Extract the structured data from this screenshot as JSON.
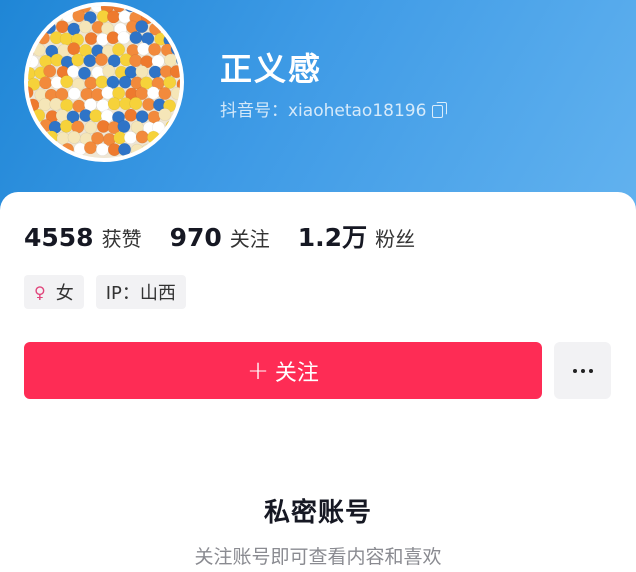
{
  "profile": {
    "name": "正义感",
    "account_id": "抖音号：xiaohetao18196"
  },
  "stats": [
    {
      "value": "4558",
      "label": "获赞"
    },
    {
      "value": "970",
      "label": "关注"
    },
    {
      "value": "1.2万",
      "label": "粉丝"
    }
  ],
  "tags": {
    "gender_icon": "♀",
    "gender": "女",
    "ip": "IP：山西"
  },
  "actions": {
    "follow_icon": "+",
    "follow_label": "关注"
  },
  "private": {
    "title": "私密账号",
    "subtitle": "关注账号即可查看内容和喜欢"
  },
  "colors": {
    "follow_button": "#fe2c55",
    "header_gradient_start": "#1f86d6",
    "header_gradient_end": "#62b2ef"
  },
  "icons": [
    "copy-icon",
    "female-icon",
    "plus-icon",
    "more-icon"
  ]
}
